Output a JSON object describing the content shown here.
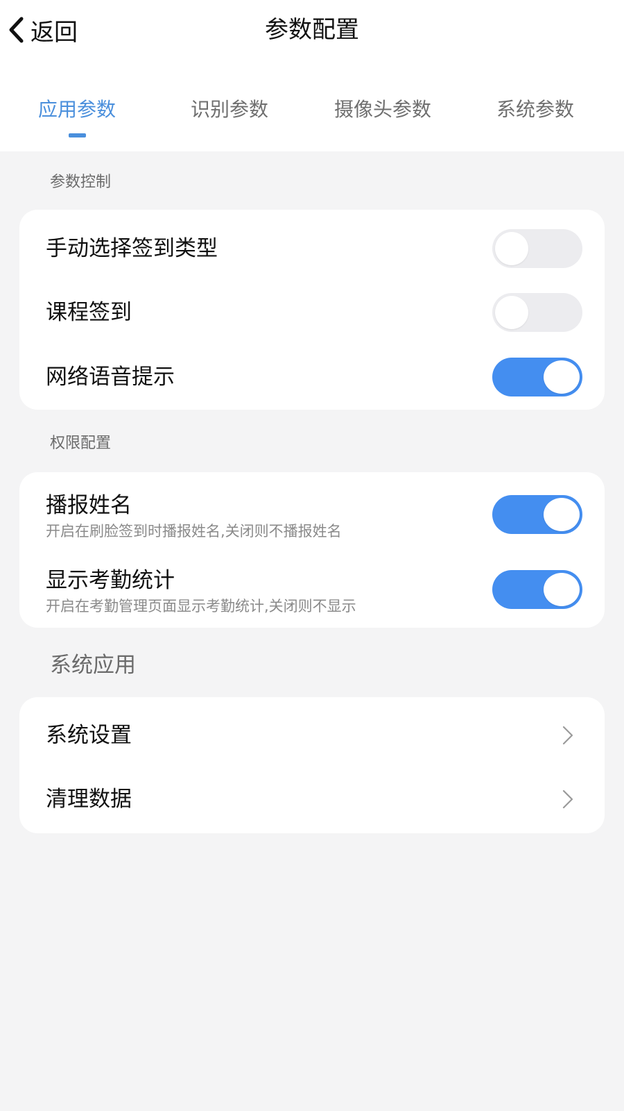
{
  "header": {
    "back_label": "返回",
    "title": "参数配置"
  },
  "tabs": [
    {
      "label": "应用参数",
      "active": true
    },
    {
      "label": "识别参数",
      "active": false
    },
    {
      "label": "摄像头参数",
      "active": false
    },
    {
      "label": "系统参数",
      "active": false
    }
  ],
  "sections": {
    "param_control": {
      "title": "参数控制",
      "items": [
        {
          "label": "手动选择签到类型",
          "enabled": false
        },
        {
          "label": "课程签到",
          "enabled": false
        },
        {
          "label": "网络语音提示",
          "enabled": true
        }
      ]
    },
    "permission": {
      "title": "权限配置",
      "items": [
        {
          "label": "播报姓名",
          "description": "开启在刷脸签到时播报姓名,关闭则不播报姓名",
          "enabled": true
        },
        {
          "label": "显示考勤统计",
          "description": "开启在考勤管理页面显示考勤统计,关闭则不显示",
          "enabled": true
        }
      ]
    },
    "system_apps": {
      "title": "系统应用",
      "items": [
        {
          "label": "系统设置"
        },
        {
          "label": "清理数据"
        }
      ]
    }
  },
  "colors": {
    "accent": "#4a8fdc",
    "toggle_on": "#448ef0",
    "toggle_off": "#ececef",
    "background": "#f4f4f5"
  }
}
